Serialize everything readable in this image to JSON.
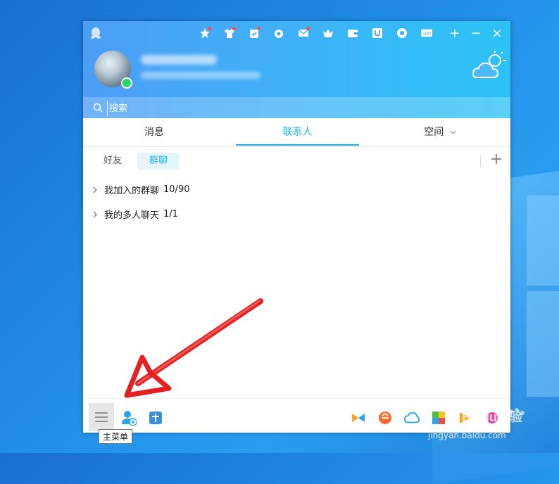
{
  "search": {
    "placeholder": "搜索"
  },
  "tabs": [
    {
      "label": "消息"
    },
    {
      "label": "联系人"
    },
    {
      "label": "空间"
    }
  ],
  "subtabs": [
    {
      "label": "好友"
    },
    {
      "label": "群聊"
    }
  ],
  "groups": [
    {
      "name": "我加入的群聊",
      "count": "10/90"
    },
    {
      "name": "我的多人聊天",
      "count": "1/1"
    }
  ],
  "tooltip": {
    "text": "主菜单"
  },
  "watermark": {
    "brand": "Baidu经验",
    "url": "jingyan.baidu.com"
  },
  "colors": {
    "accent": "#12b7f5",
    "online": "#2bd46a",
    "arrow": "#e52020"
  }
}
